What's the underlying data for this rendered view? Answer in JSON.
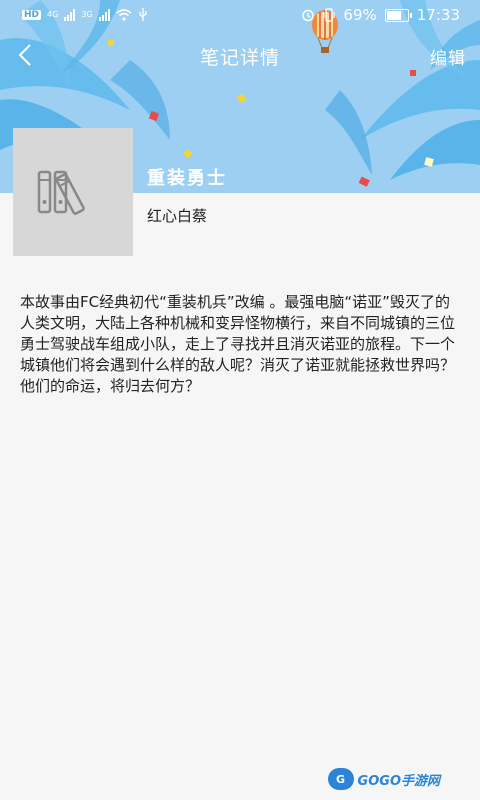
{
  "status_bar": {
    "hd_tag": "HD",
    "net1": "4G",
    "net2": "3G",
    "battery_percent": "69%",
    "battery_level": 0.69,
    "time": "17:33"
  },
  "navbar": {
    "title": "笔记详情",
    "edit_label": "编辑"
  },
  "book": {
    "title": "重装勇士",
    "author": "红心白蔡",
    "description": "本故事由FC经典初代“重装机兵”改编 。最强电脑“诺亚”毁灭了的人类文明，大陆上各种机械和变异怪物横行，来自不同城镇的三位勇士驾驶战车组成小队，走上了寻找并且消灭诺亚的旅程。下一个城镇他们将会遇到什么样的敌人呢？消灭了诺亚就能拯救世界吗？他们的命运，将归去何方？"
  },
  "watermark": {
    "logo_text": "G",
    "text": "GOGO手游网"
  },
  "colors": {
    "banner_sky": "#9ccff2",
    "palm": "#5cb8ec",
    "page_bg": "#f6f6f6",
    "cover_bg": "#d7d7d7",
    "watermark": "#2c84d8"
  }
}
